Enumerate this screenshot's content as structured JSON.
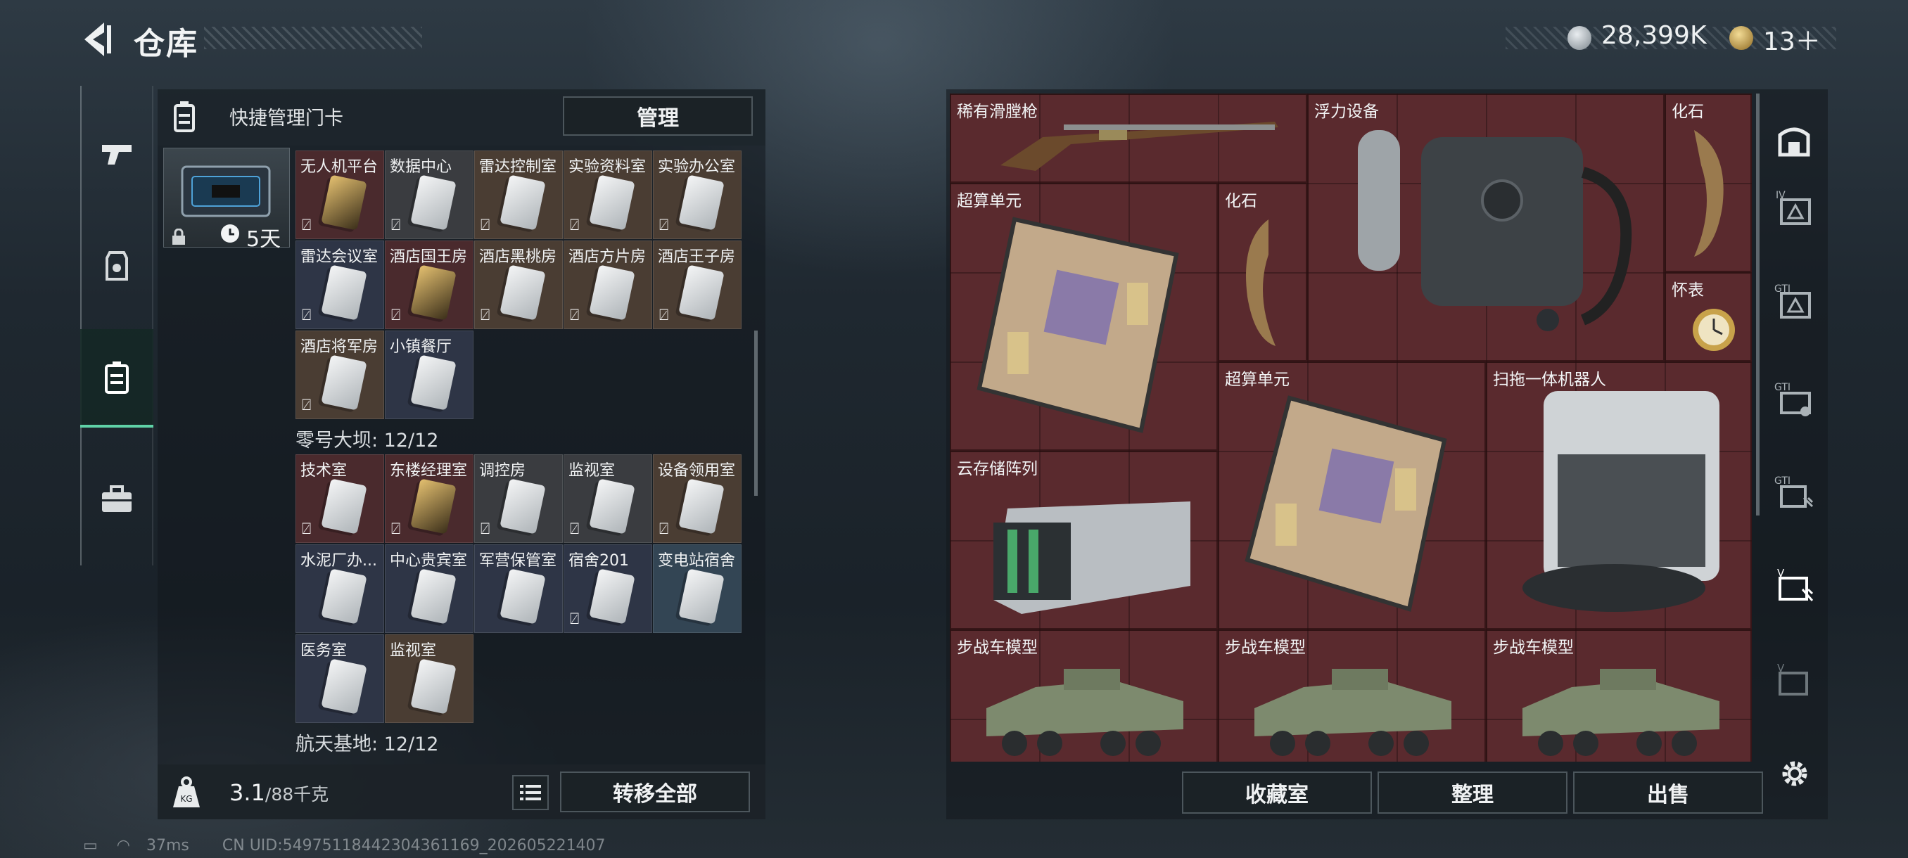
{
  "header": {
    "title": "仓库",
    "currency_a": "28,399K",
    "currency_b": "13＋"
  },
  "left_nav": {
    "items": [
      "weapon",
      "armor",
      "keycards",
      "toolbox"
    ],
    "active": "keycards"
  },
  "keycard_panel": {
    "quick_manage_label": "快捷管理门卡",
    "manage_button": "管理",
    "case_timer": "5天",
    "group1": [
      "无人机平台",
      "数据中心",
      "雷达控制室",
      "实验资料室",
      "实验办公室",
      "雷达会议室",
      "酒店国王房",
      "酒店黑桃房",
      "酒店方片房",
      "酒店王子房",
      "酒店将军房",
      "小镇餐厅"
    ],
    "section2_label": "零号大坝: 12/12",
    "group2": [
      "技术室",
      "东楼经理室",
      "调控房",
      "监视室",
      "设备领用室",
      "水泥厂办...",
      "中心贵宾室",
      "军营保管室",
      "宿舍201",
      "变电站宿舍",
      "医务室",
      "监视室"
    ],
    "section3_label": "航天基地: 12/12",
    "weight_value": "3.1",
    "weight_max": "/88千克",
    "transfer_all_button": "转移全部"
  },
  "stash": {
    "items": [
      "稀有滑膛枪",
      "浮力设备",
      "化石",
      "超算单元",
      "化石",
      "怀表",
      "超算单元",
      "扫拖一体机器人",
      "云存储阵列",
      "步战车模型",
      "步战车模型",
      "步战车模型"
    ]
  },
  "bottom_buttons": {
    "collection": "收藏室",
    "organize": "整理",
    "sell": "出售"
  },
  "status_bar": {
    "ping": "37ms",
    "uid": "CN UID:549751184423043611​69_202605221407"
  },
  "colors": {
    "accent": "#5fd2a7",
    "stash_bg": "#5a2a2e"
  }
}
